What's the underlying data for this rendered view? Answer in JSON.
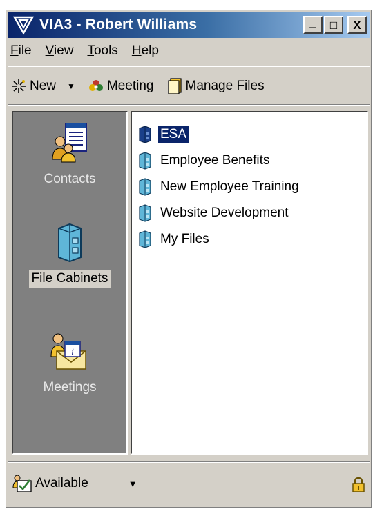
{
  "window": {
    "title": "VIA3 - Robert Williams"
  },
  "title_buttons": [
    "_",
    "□",
    "X"
  ],
  "menu": [
    {
      "label": "File",
      "key": "F",
      "rest": "ile"
    },
    {
      "label": "View",
      "key": "V",
      "rest": "iew"
    },
    {
      "label": "Tools",
      "key": "T",
      "rest": "ools"
    },
    {
      "label": "Help",
      "key": "H",
      "rest": "elp"
    }
  ],
  "toolbar": {
    "new_label": "New",
    "meeting_label": "Meeting",
    "manage_files_label": "Manage Files"
  },
  "sidebar": {
    "items": [
      {
        "label": "Contacts",
        "icon": "contacts-icon",
        "active": false
      },
      {
        "label": "File Cabinets",
        "icon": "file-cabinet-icon",
        "active": true
      },
      {
        "label": "Meetings",
        "icon": "meetings-icon",
        "active": false
      }
    ]
  },
  "cabinets": [
    {
      "label": "ESA",
      "selected": true
    },
    {
      "label": "Employee Benefits",
      "selected": false
    },
    {
      "label": "New Employee Training",
      "selected": false
    },
    {
      "label": "Website Development",
      "selected": false
    },
    {
      "label": "My Files",
      "selected": false
    }
  ],
  "status": {
    "label": "Available",
    "icon": "presence-icon",
    "lock_icon": "lock-icon"
  },
  "colors": {
    "title_start": "#0a246a",
    "title_end": "#a6caf0",
    "face": "#d4d0c8",
    "sidebar": "#808080",
    "selection": "#0a246a"
  }
}
